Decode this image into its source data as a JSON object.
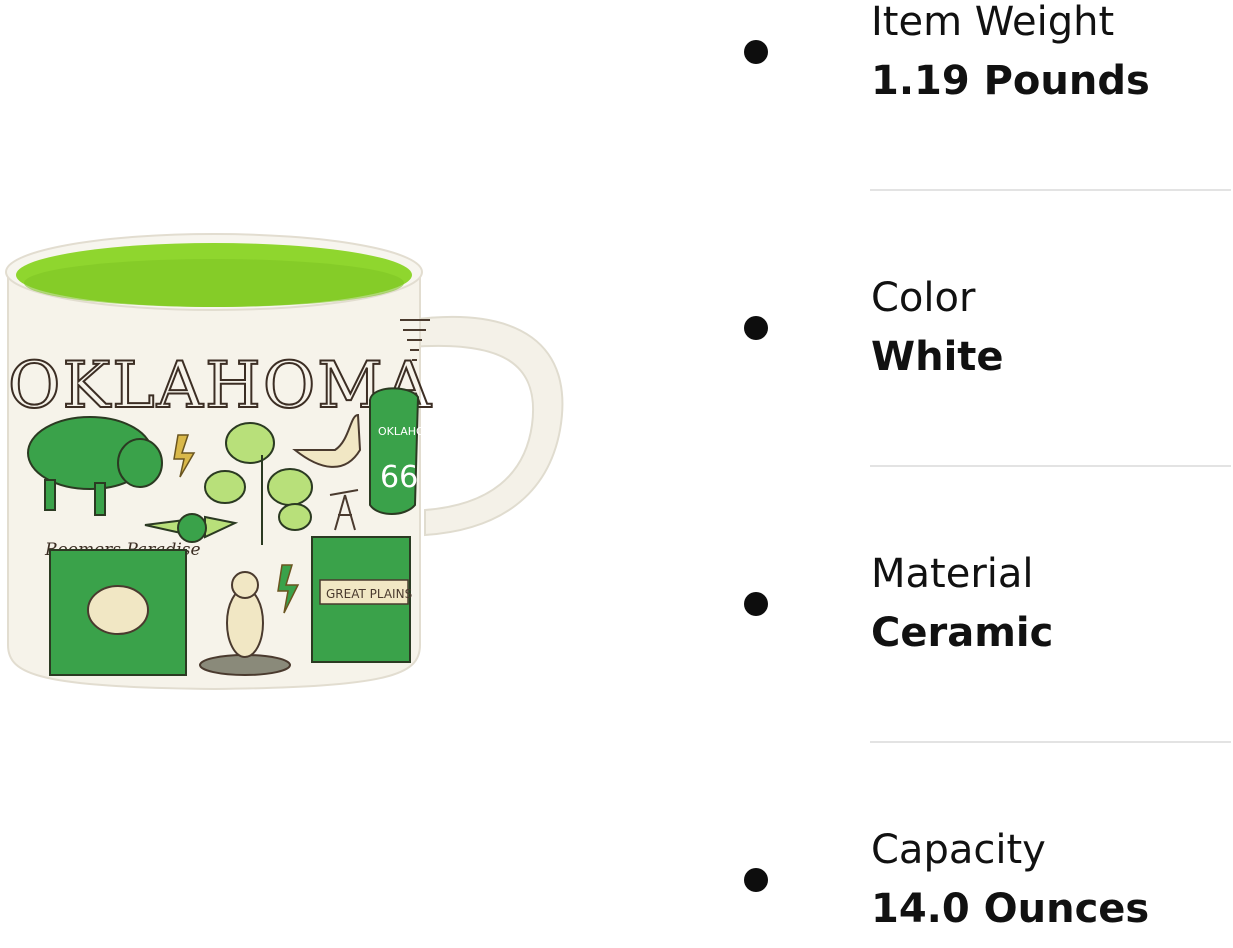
{
  "product_image": {
    "alt": "Oklahoma mug",
    "mug_text": "OKLAHOMA",
    "route_sign_top": "OKLAHOMA",
    "route_sign_number": "66",
    "script_text": "Boomers Paradise",
    "sign_text": "GREAT PLAINS"
  },
  "specs": [
    {
      "label": "Item Weight",
      "value": "1.19 Pounds"
    },
    {
      "label": "Color",
      "value": "White"
    },
    {
      "label": "Material",
      "value": "Ceramic"
    },
    {
      "label": "Capacity",
      "value": "14.0 Ounces"
    }
  ],
  "colors": {
    "mug_inner": "#8fd62e",
    "accent_green": "#3aa24a",
    "light_green": "#b8e07a",
    "bullet": "#0d0d0d",
    "divider": "#e3e3e3"
  }
}
